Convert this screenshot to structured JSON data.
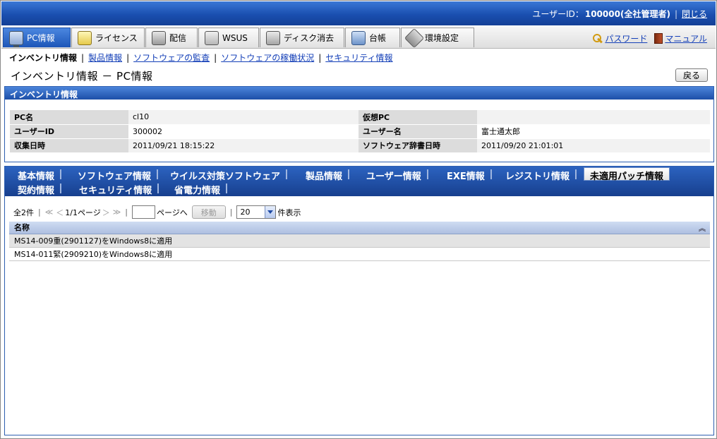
{
  "header": {
    "user_id_label": "ユーザーID：",
    "user_id_value": "100000(全社管理者)",
    "close_link": "閉じる"
  },
  "menu": {
    "tabs": [
      {
        "label": "PC情報",
        "icon": "pc-icon"
      },
      {
        "label": "ライセンス",
        "icon": "license-icon"
      },
      {
        "label": "配信",
        "icon": "distribution-icon"
      },
      {
        "label": "WSUS",
        "icon": "wsus-icon"
      },
      {
        "label": "ディスク消去",
        "icon": "disk-erase-icon"
      },
      {
        "label": "台帳",
        "icon": "ledger-icon"
      },
      {
        "label": "環境設定",
        "icon": "settings-tools-icon"
      }
    ],
    "password_link": "パスワード",
    "manual_link": "マニュアル"
  },
  "subnav": {
    "current": "インベントリ情報",
    "links": [
      "製品情報",
      "ソフトウェアの監査",
      "ソフトウェアの稼働状況",
      "セキュリティ情報"
    ]
  },
  "page": {
    "title": "インベントリ情報 － PC情報",
    "back_button": "戻る"
  },
  "inventory": {
    "header": "インベントリ情報",
    "rows": [
      {
        "l1": "PC名",
        "v1": "cl10",
        "l2": "仮想PC",
        "v2": ""
      },
      {
        "l1": "ユーザーID",
        "v1": "300002",
        "l2": "ユーザー名",
        "v2": "富士通太郎"
      },
      {
        "l1": "収集日時",
        "v1": "2011/09/21 18:15:22",
        "l2": "ソフトウェア辞書日時",
        "v2": "2011/09/20 21:01:01"
      }
    ]
  },
  "detail_tabs": [
    "基本情報",
    "ソフトウェア情報",
    "ウイルス対策ソフトウェア",
    "製品情報",
    "ユーザー情報",
    "EXE情報",
    "レジストリ情報",
    "未適用パッチ情報",
    "契約情報",
    "セキュリティ情報",
    "省電力情報"
  ],
  "pager": {
    "total": "全2件",
    "first": "≪",
    "prev": "＜",
    "page_info": "1/1ページ",
    "next": "＞",
    "last": "≫",
    "goto_value": "",
    "goto_suffix": "ページへ",
    "move_button": "移動",
    "per_page_value": "20",
    "per_page_suffix": "件表示"
  },
  "grid": {
    "column_header": "名称",
    "sort_icon": "double-chevron-up-icon",
    "rows": [
      "MS14-009重(2901127)をWindows8に適用",
      "MS14-011緊(2909210)をWindows8に適用"
    ]
  }
}
